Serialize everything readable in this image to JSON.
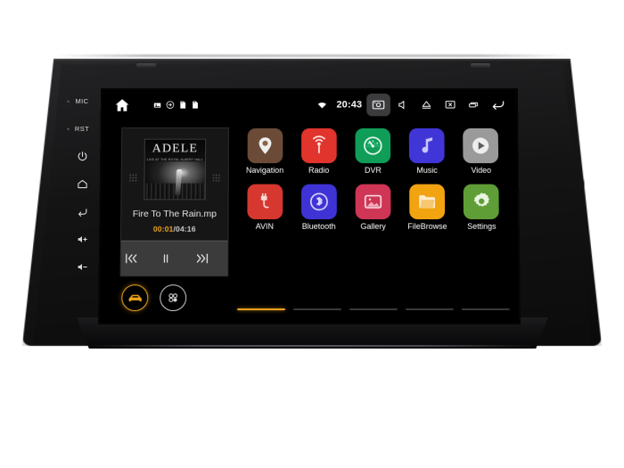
{
  "device": {
    "type": "car-head-unit",
    "hard_keys": [
      {
        "name": "mic",
        "label": "MIC"
      },
      {
        "name": "reset",
        "label": "RST"
      },
      {
        "name": "power",
        "icon": "power-icon"
      },
      {
        "name": "home",
        "icon": "home-outline-icon"
      },
      {
        "name": "back",
        "icon": "back-arrow-icon"
      },
      {
        "name": "volume-up",
        "icon": "volume-up-icon"
      },
      {
        "name": "volume-down",
        "icon": "volume-down-icon"
      }
    ]
  },
  "statusbar": {
    "home_icon": "home-icon",
    "left_icons": [
      {
        "name": "screenshot-notification-icon"
      },
      {
        "name": "download-notification-icon"
      },
      {
        "name": "sdcard-notification-icon"
      },
      {
        "name": "sdcard2-notification-icon"
      }
    ],
    "wifi_icon": "wifi-icon",
    "time": "20:43",
    "right_icons": [
      {
        "name": "camera-screenshot-icon",
        "active": true
      },
      {
        "name": "mute-icon",
        "active": false
      },
      {
        "name": "eject-icon",
        "active": false
      },
      {
        "name": "screen-off-icon",
        "active": false
      },
      {
        "name": "recents-icon",
        "active": false
      },
      {
        "name": "back-icon",
        "active": false
      }
    ]
  },
  "music_widget": {
    "album_art_title": "ADELE",
    "album_art_subtitle": "LIVE AT THE ROYAL ALBERT HALL",
    "track_title": "Fire To The Rain.mp",
    "current_time": "00:01",
    "separator": "/",
    "total_time": "04:16",
    "controls": [
      {
        "name": "previous-button",
        "glyph": "⧏⧏"
      },
      {
        "name": "pause-button",
        "glyph": "‖"
      },
      {
        "name": "next-button",
        "glyph": "⧐⧐"
      }
    ]
  },
  "dock": [
    {
      "name": "car-mode-button",
      "icon": "car-icon",
      "active": true,
      "color": "#f0a51e"
    },
    {
      "name": "all-apps-button",
      "icon": "apps-grid-icon",
      "active": false,
      "color": "#cfcfcf"
    }
  ],
  "apps": [
    {
      "label": "Navigation",
      "icon": "map-pin-icon",
      "color": "#6b4b38"
    },
    {
      "label": "Radio",
      "icon": "radio-waves-icon",
      "color": "#e0342c"
    },
    {
      "label": "DVR",
      "icon": "gauge-icon",
      "color": "#0f9d58"
    },
    {
      "label": "Music",
      "icon": "music-note-icon",
      "color": "#4036d8"
    },
    {
      "label": "Video",
      "icon": "play-circle-icon",
      "color": "#9a9a9a"
    },
    {
      "label": "AVIN",
      "icon": "avin-plug-icon",
      "color": "#d6372f"
    },
    {
      "label": "Bluetooth",
      "icon": "bluetooth-icon",
      "color": "#3f33d6"
    },
    {
      "label": "Gallery",
      "icon": "photo-icon",
      "color": "#cf3555"
    },
    {
      "label": "FileBrowse",
      "icon": "folder-icon",
      "color": "#f2a310"
    },
    {
      "label": "Settings",
      "icon": "gear-icon",
      "color": "#5f9e36"
    }
  ],
  "pages": {
    "count": 5,
    "active_index": 0
  },
  "colors": {
    "accent": "#f0a51e",
    "screen_bg": "#000000",
    "bezel": "#18181a"
  }
}
